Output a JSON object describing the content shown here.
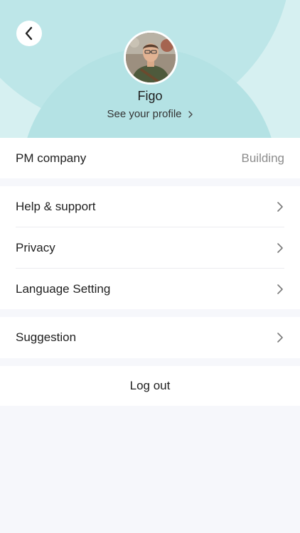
{
  "profile": {
    "name": "Figo",
    "link_label": "See your profile"
  },
  "company": {
    "label": "PM company",
    "value": "Building"
  },
  "menu_group_1": [
    {
      "label": "Help & support"
    },
    {
      "label": "Privacy"
    },
    {
      "label": "Language Setting"
    }
  ],
  "menu_group_2": [
    {
      "label": "Suggestion"
    }
  ],
  "logout_label": "Log out",
  "colors": {
    "header_bg": "#d6f0f1",
    "accent": "#b4e2e4",
    "page_bg": "#f6f7fb"
  }
}
